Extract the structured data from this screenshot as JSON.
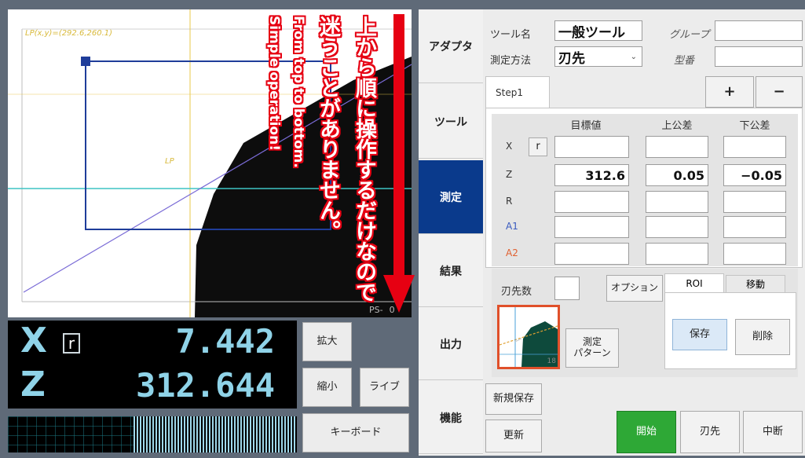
{
  "viewer": {
    "lp_label": "LP(x,y)=(292.6,260.1)",
    "lp_marker": "LP",
    "ps_label": "PS-",
    "ps_suffix": "0"
  },
  "annotation": {
    "line1": "上から順に操作するだけなので",
    "line2": "迷うことがありません。",
    "line3": "From top to bottom.",
    "line4": "Simple operation!"
  },
  "readout": {
    "x_label": "X",
    "r_label": "r",
    "x_value": "7.442",
    "z_label": "Z",
    "z_value": "312.644"
  },
  "view_buttons": {
    "zoom_in": "拡大",
    "zoom_out": "縮小",
    "live": "ライブ",
    "keyboard": "キーボード"
  },
  "nav": {
    "items": [
      "アダプタ",
      "ツール",
      "測定",
      "結果",
      "出力",
      "機能"
    ],
    "active_index": 2
  },
  "tool": {
    "name_label": "ツール名",
    "name_value": "一般ツール",
    "group_label": "グループ",
    "group_value": "",
    "method_label": "測定方法",
    "method_value": "刃先",
    "number_label": "型番",
    "number_value": ""
  },
  "steps": {
    "tab_label": "Step1",
    "add_label": "+",
    "remove_label": "−"
  },
  "table": {
    "headers": [
      "目標値",
      "上公差",
      "下公差"
    ],
    "rows": [
      {
        "label": "X",
        "target": "",
        "upper": "",
        "lower": "",
        "color": "#333333"
      },
      {
        "label": "Z",
        "target": "312.6",
        "upper": "0.05",
        "lower": "−0.05",
        "color": "#333333"
      },
      {
        "label": "R",
        "target": "",
        "upper": "",
        "lower": "",
        "color": "#333333"
      },
      {
        "label": "A1",
        "target": "",
        "upper": "",
        "lower": "",
        "color": "#3a5bbf"
      },
      {
        "label": "A2",
        "target": "",
        "upper": "",
        "lower": "",
        "color": "#e06030"
      }
    ],
    "r_button": "r"
  },
  "options": {
    "edge_count_label": "刃先数",
    "edge_count_value": "",
    "option_button": "オプション",
    "pattern_button": "測定\nパターン",
    "pattern_number": "18"
  },
  "roi": {
    "tab_roi": "ROI",
    "tab_move": "移動",
    "save": "保存",
    "delete": "削除"
  },
  "actions": {
    "new_save": "新規保存",
    "update": "更新",
    "start": "開始",
    "edge": "刃先",
    "abort": "中断"
  },
  "colors": {
    "accent_blue": "#0a3a8c",
    "start_green": "#2ea836",
    "readout_text": "#8fd3e8",
    "annotation_red": "#e60012"
  }
}
